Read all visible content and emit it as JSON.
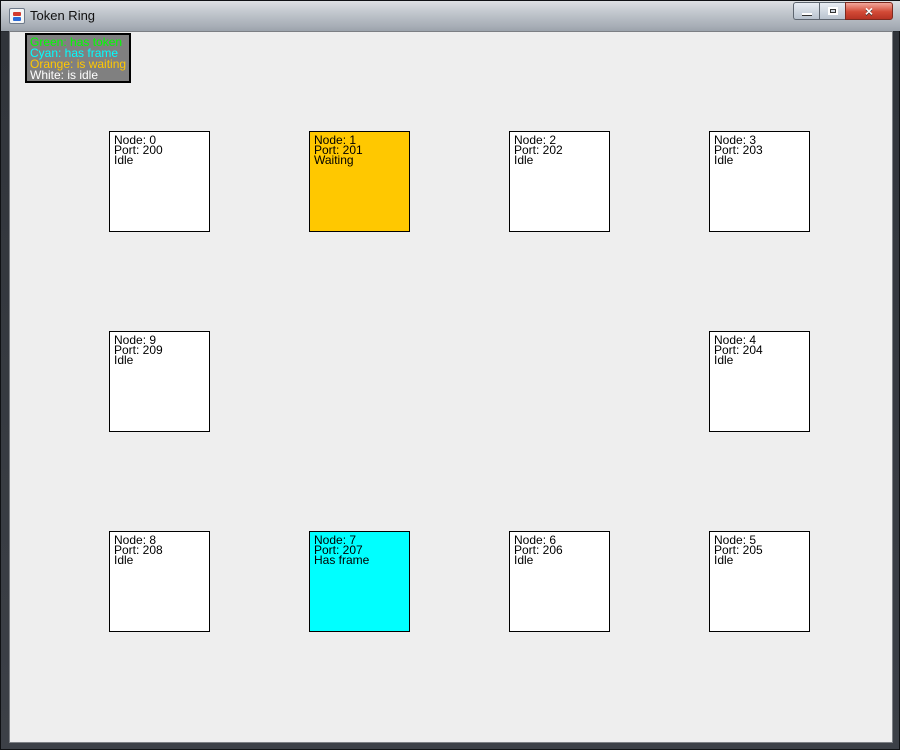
{
  "window": {
    "title": "Token Ring",
    "controls": {
      "minimize": "minimize",
      "maximize": "maximize",
      "close": "close"
    }
  },
  "legend": {
    "items": [
      {
        "text": "Green: has token",
        "color": "#00ff00"
      },
      {
        "text": "Cyan: has frame",
        "color": "#00ffff"
      },
      {
        "text": "Orange: is waiting",
        "color": "#ffc800"
      },
      {
        "text": "White: is idle",
        "color": "#ffffff"
      }
    ],
    "background": "#808080"
  },
  "nodes": [
    {
      "node": "Node: 0",
      "port": "Port: 200",
      "status": "Idle",
      "state": "idle",
      "color": "#ffffff"
    },
    {
      "node": "Node: 1",
      "port": "Port: 201",
      "status": "Waiting",
      "state": "waiting",
      "color": "#ffc800"
    },
    {
      "node": "Node: 2",
      "port": "Port: 202",
      "status": "Idle",
      "state": "idle",
      "color": "#ffffff"
    },
    {
      "node": "Node: 3",
      "port": "Port: 203",
      "status": "Idle",
      "state": "idle",
      "color": "#ffffff"
    },
    {
      "node": "Node: 4",
      "port": "Port: 204",
      "status": "Idle",
      "state": "idle",
      "color": "#ffffff"
    },
    {
      "node": "Node: 5",
      "port": "Port: 205",
      "status": "Idle",
      "state": "idle",
      "color": "#ffffff"
    },
    {
      "node": "Node: 6",
      "port": "Port: 206",
      "status": "Idle",
      "state": "idle",
      "color": "#ffffff"
    },
    {
      "node": "Node: 7",
      "port": "Port: 207",
      "status": "Has frame",
      "state": "has-frame",
      "color": "#00ffff"
    },
    {
      "node": "Node: 8",
      "port": "Port: 208",
      "status": "Idle",
      "state": "idle",
      "color": "#ffffff"
    },
    {
      "node": "Node: 9",
      "port": "Port: 209",
      "status": "Idle",
      "state": "idle",
      "color": "#ffffff"
    }
  ]
}
